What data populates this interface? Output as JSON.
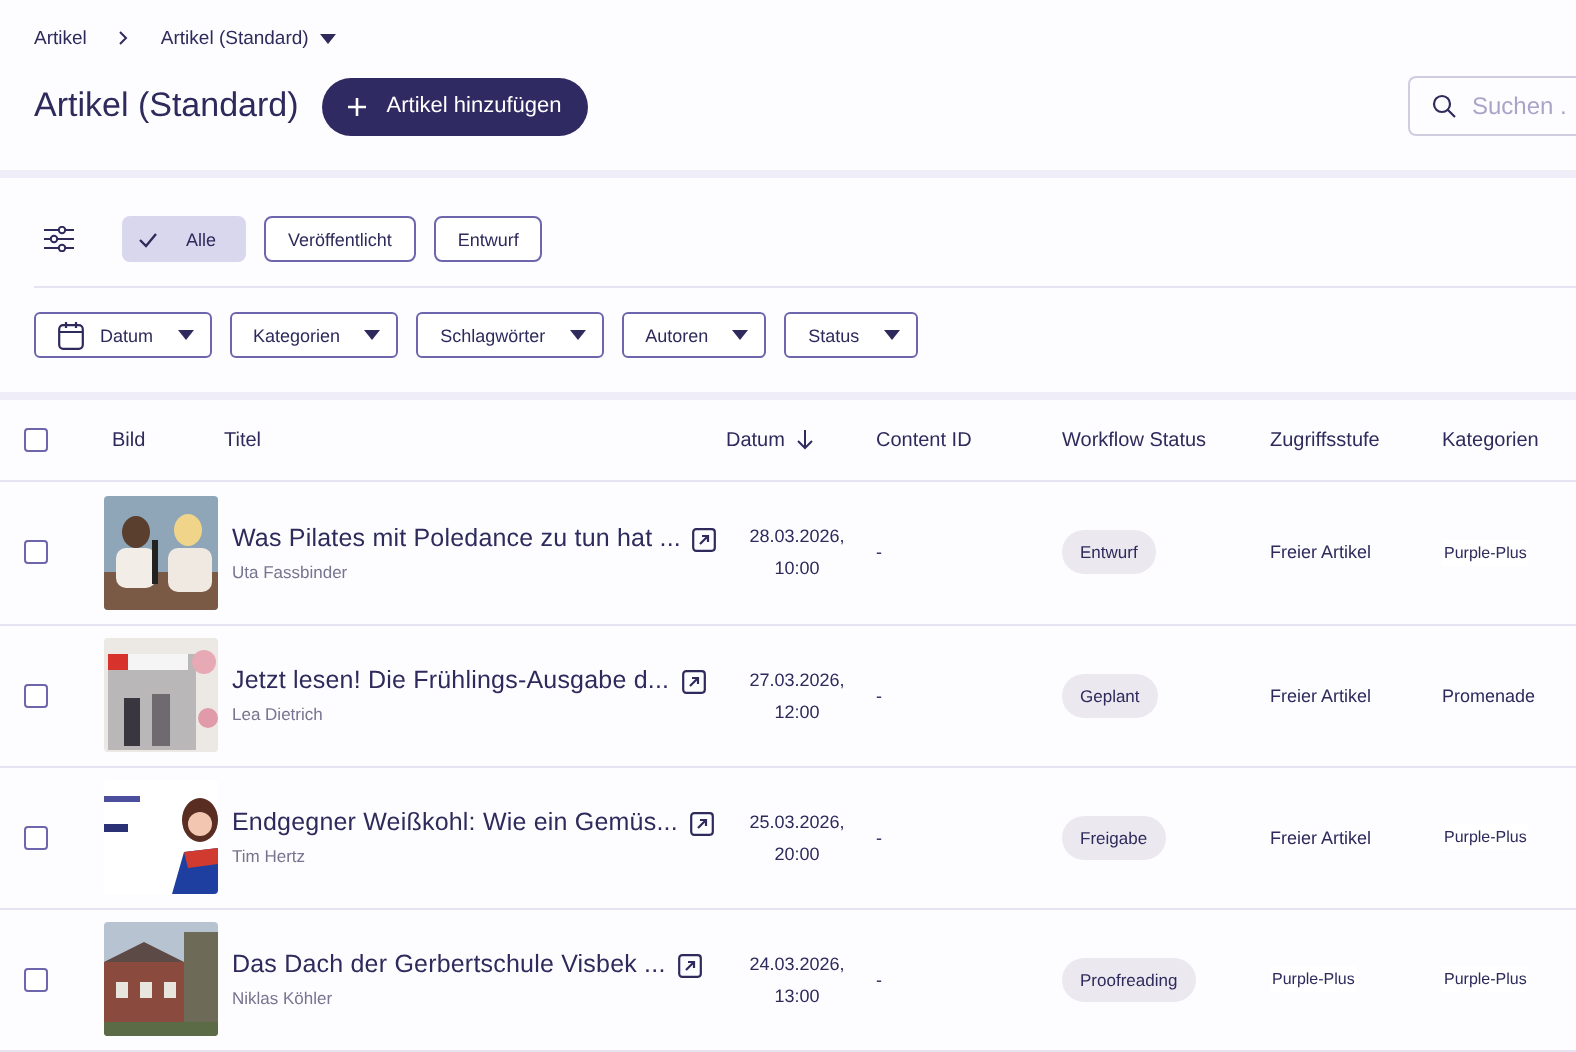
{
  "breadcrumb": {
    "items": [
      "Artikel",
      "Artikel (Standard)"
    ]
  },
  "page_title": "Artikel (Standard)",
  "add_button": "Artikel hinzufügen",
  "search": {
    "placeholder": "Suchen ."
  },
  "status_filters": [
    {
      "label": "Alle",
      "selected": true
    },
    {
      "label": "Veröffentlicht",
      "selected": false
    },
    {
      "label": "Entwurf",
      "selected": false
    }
  ],
  "filters": [
    {
      "label": "Datum",
      "kind": "date"
    },
    {
      "label": "Kategorien",
      "kind": "select"
    },
    {
      "label": "Schlagwörter",
      "kind": "select"
    },
    {
      "label": "Autoren",
      "kind": "select"
    },
    {
      "label": "Status",
      "kind": "select"
    }
  ],
  "table": {
    "all_checked": false,
    "columns": [
      {
        "label": "Bild",
        "sorted": false
      },
      {
        "label": "Titel",
        "sorted": false
      },
      {
        "label": "Datum",
        "sorted": true
      },
      {
        "label": "Content ID",
        "sorted": false
      },
      {
        "label": "Workflow Status",
        "sorted": false
      },
      {
        "label": "Zugriffsstufe",
        "sorted": false
      },
      {
        "label": "Kategorien",
        "sorted": false
      }
    ],
    "rows": [
      {
        "checked": false,
        "title": "Was Pilates mit Poledance zu tun hat ...",
        "author": "Uta Fassbinder",
        "date": "28.03.2026,",
        "time": "10:00",
        "content_id": "-",
        "workflow_status": "Entwurf",
        "access": {
          "label": "Freier Artikel",
          "kind": "text"
        },
        "category": {
          "label": "Purple-Plus",
          "kind": "tag"
        }
      },
      {
        "checked": false,
        "title": "Jetzt lesen! Die Frühlings-Ausgabe d...",
        "author": "Lea Dietrich",
        "date": "27.03.2026,",
        "time": "12:00",
        "content_id": "-",
        "workflow_status": "Geplant",
        "access": {
          "label": "Freier Artikel",
          "kind": "text"
        },
        "category": {
          "label": "Promenade",
          "kind": "text"
        }
      },
      {
        "checked": false,
        "title": "Endgegner Weißkohl: Wie ein Gemüs...",
        "author": "Tim Hertz",
        "date": "25.03.2026,",
        "time": "20:00",
        "content_id": "-",
        "workflow_status": "Freigabe",
        "access": {
          "label": "Freier Artikel",
          "kind": "text"
        },
        "category": {
          "label": "Purple-Plus",
          "kind": "tag"
        }
      },
      {
        "checked": false,
        "title": "Das Dach der Gerbertschule Visbek ...",
        "author": "Niklas Köhler",
        "date": "24.03.2026,",
        "time": "13:00",
        "content_id": "-",
        "workflow_status": "Proofreading",
        "access": {
          "label": "Purple-Plus",
          "kind": "tag"
        },
        "category": {
          "label": "Purple-Plus",
          "kind": "tag"
        }
      }
    ]
  }
}
